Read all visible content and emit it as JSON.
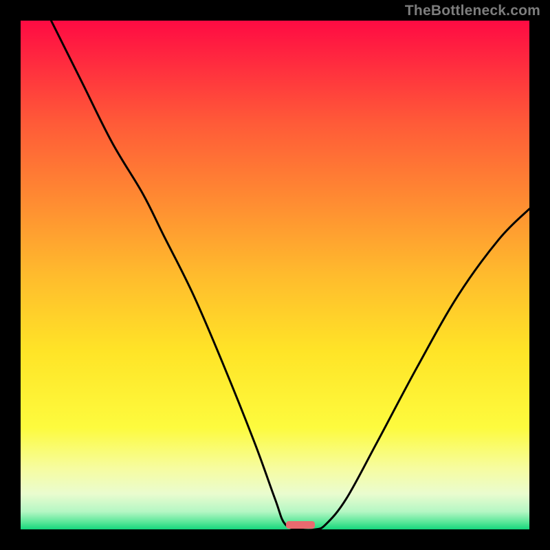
{
  "watermark": "TheBottleneck.com",
  "colors": {
    "background": "#000000",
    "curve_stroke": "#000000",
    "target_marker": "#e96a6f",
    "gradient_stops": [
      {
        "offset": 0.0,
        "color": "#ff0b43"
      },
      {
        "offset": 0.08,
        "color": "#ff2a3f"
      },
      {
        "offset": 0.2,
        "color": "#ff5a38"
      },
      {
        "offset": 0.35,
        "color": "#ff8a32"
      },
      {
        "offset": 0.5,
        "color": "#ffbb2d"
      },
      {
        "offset": 0.65,
        "color": "#ffe427"
      },
      {
        "offset": 0.8,
        "color": "#fdfb3e"
      },
      {
        "offset": 0.88,
        "color": "#f6fca0"
      },
      {
        "offset": 0.93,
        "color": "#eafccf"
      },
      {
        "offset": 0.965,
        "color": "#b5f7c4"
      },
      {
        "offset": 0.985,
        "color": "#5de89a"
      },
      {
        "offset": 1.0,
        "color": "#15d67c"
      }
    ]
  },
  "chart_data": {
    "type": "line",
    "title": "",
    "xlabel": "",
    "ylabel": "",
    "xlim": [
      0,
      100
    ],
    "ylim": [
      0,
      100
    ],
    "target_x": 55,
    "curve": [
      {
        "x": 6,
        "y": 100
      },
      {
        "x": 12,
        "y": 88
      },
      {
        "x": 18,
        "y": 76
      },
      {
        "x": 24,
        "y": 66
      },
      {
        "x": 28,
        "y": 58
      },
      {
        "x": 34,
        "y": 46
      },
      {
        "x": 40,
        "y": 32
      },
      {
        "x": 46,
        "y": 17
      },
      {
        "x": 50,
        "y": 6
      },
      {
        "x": 52,
        "y": 1
      },
      {
        "x": 55,
        "y": 0
      },
      {
        "x": 58,
        "y": 0
      },
      {
        "x": 60,
        "y": 1
      },
      {
        "x": 64,
        "y": 6
      },
      {
        "x": 70,
        "y": 17
      },
      {
        "x": 78,
        "y": 32
      },
      {
        "x": 86,
        "y": 46
      },
      {
        "x": 94,
        "y": 57
      },
      {
        "x": 100,
        "y": 63
      }
    ],
    "annotations": []
  }
}
